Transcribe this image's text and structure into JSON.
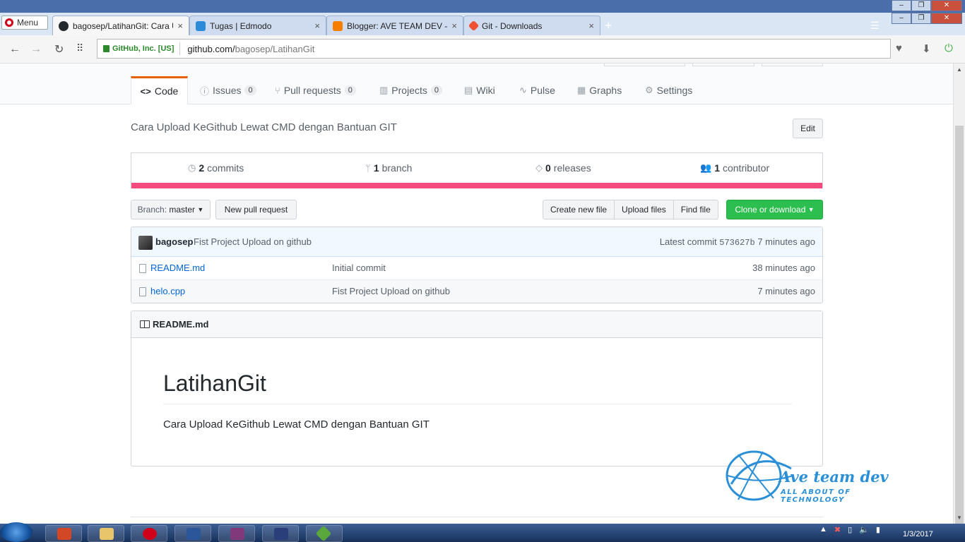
{
  "browser": {
    "menu_label": "Menu",
    "tabs": [
      {
        "title": "bagosep/LatihanGit: Cara U",
        "favicon_color": "#24292e",
        "close": "×"
      },
      {
        "title": "Tugas | Edmodo",
        "favicon_color": "#2c8bd8",
        "close": "×"
      },
      {
        "title": "Blogger: AVE TEAM DEV -",
        "favicon_color": "#f57d00",
        "close": "×"
      },
      {
        "title": "Git - Downloads",
        "favicon_color": "#f05133",
        "close": "×"
      }
    ],
    "new_tab": "+",
    "site_identity": "GitHub, Inc. [US]",
    "url_host": "github.com/",
    "url_path": "bagosep/LatihanGit"
  },
  "repo_nav": {
    "code": "Code",
    "issues": {
      "label": "Issues",
      "count": "0"
    },
    "pull_requests": {
      "label": "Pull requests",
      "count": "0"
    },
    "projects": {
      "label": "Projects",
      "count": "0"
    },
    "wiki": "Wiki",
    "pulse": "Pulse",
    "graphs": "Graphs",
    "settings": "Settings"
  },
  "repo": {
    "description": "Cara Upload KeGithub Lewat CMD dengan Bantuan GIT",
    "edit_label": "Edit",
    "summary": {
      "commits_count": "2",
      "commits_label": "commits",
      "branch_count": "1",
      "branch_label": "branch",
      "releases_count": "0",
      "releases_label": "releases",
      "contributor_count": "1",
      "contributor_label": "contributor"
    },
    "language_color": "#f34b7d"
  },
  "file_nav": {
    "branch_prefix": "Branch:",
    "branch_name": "master",
    "new_pull_request": "New pull request",
    "create_new_file": "Create new file",
    "upload_files": "Upload files",
    "find_file": "Find file",
    "clone_or_download": "Clone or download"
  },
  "commit": {
    "user": "bagosep",
    "message": "Fist Project Upload on github",
    "latest_label": "Latest commit",
    "sha": "573627b",
    "age": "7 minutes ago"
  },
  "files": [
    {
      "name": "README.md",
      "message": "Initial commit",
      "age": "38 minutes ago"
    },
    {
      "name": "helo.cpp",
      "message": "Fist Project Upload on github",
      "age": "7 minutes ago"
    }
  ],
  "readme": {
    "header": "README.md",
    "title": "LatihanGit",
    "body": "Cara Upload KeGithub Lewat CMD dengan Bantuan GIT"
  },
  "watermark": {
    "title": "Ave team dev",
    "subtitle": "ALL ABOUT OF TECHNOLOGY"
  },
  "taskbar": {
    "date": "1/3/2017"
  }
}
